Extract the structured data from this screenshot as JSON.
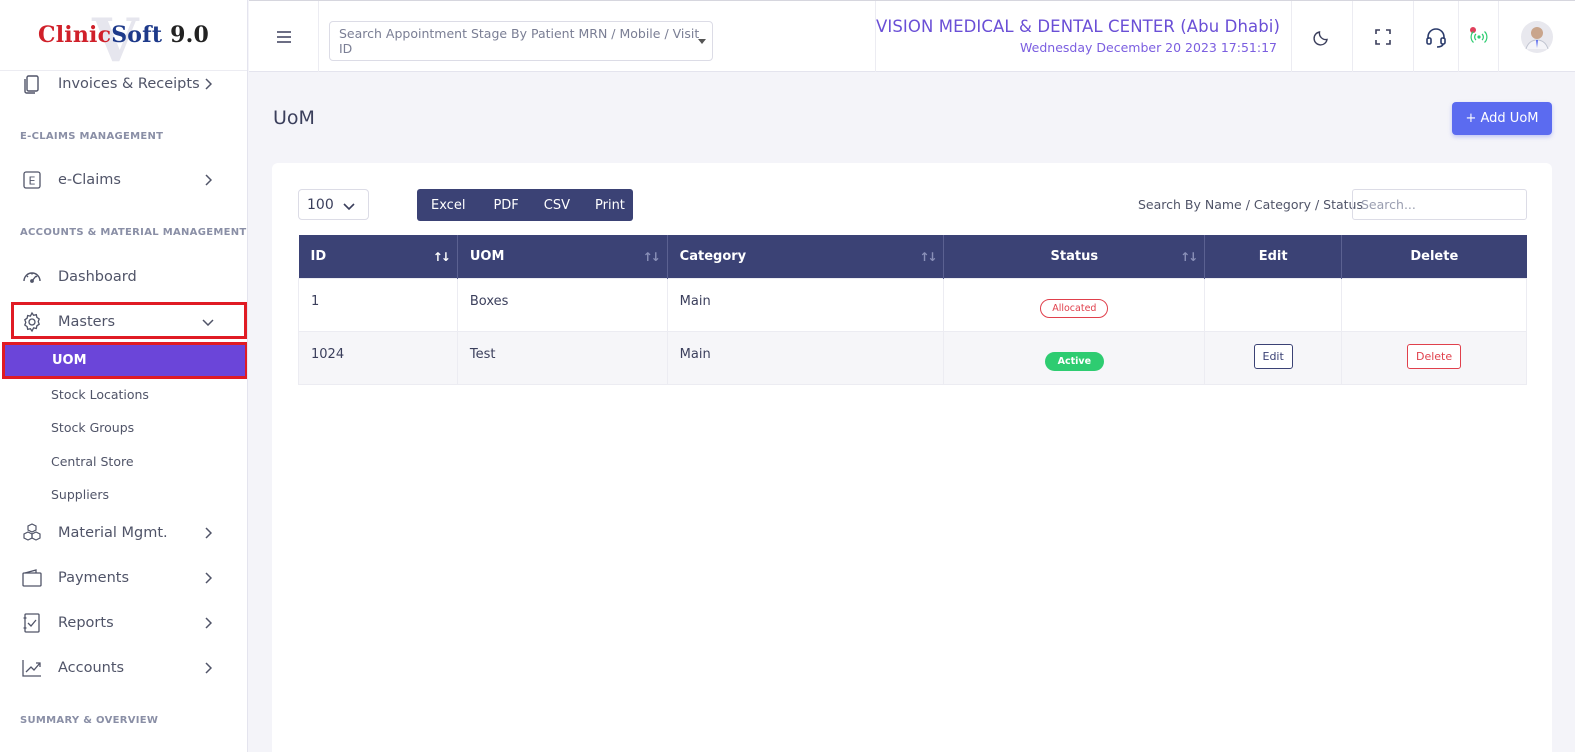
{
  "logo": {
    "part1": "Clinic",
    "part2": "Soft",
    "part3": " 9.0",
    "watermark": "V"
  },
  "sidebar": {
    "invoices": "Invoices & Receipts",
    "section_eclaims": "E-CLAIMS MANAGEMENT",
    "eclaims": "e-Claims",
    "section_accounts": "ACCOUNTS & MATERIAL MANAGEMENT",
    "dashboard": "Dashboard",
    "masters": "Masters",
    "uom": "UOM",
    "stock_locations": "Stock Locations",
    "stock_groups": "Stock Groups",
    "central_store": "Central Store",
    "suppliers": "Suppliers",
    "material_mgmt": "Material Mgmt.",
    "payments": "Payments",
    "reports": "Reports",
    "accounts": "Accounts",
    "section_summary": "SUMMARY & OVERVIEW"
  },
  "header": {
    "search_placeholder": "Search Appointment Stage By Patient MRN / Mobile / Visit ID",
    "center_name": "VISION MEDICAL & DENTAL CENTER (Abu Dhabi)",
    "datetime": "Wednesday December 20 2023 17:51:17"
  },
  "page": {
    "title": "UoM",
    "add_button": "+ Add UoM",
    "page_length": "100",
    "export_buttons": [
      "Excel",
      "PDF",
      "CSV",
      "Print"
    ],
    "search_label": "Search By Name / Category / Status",
    "search_placeholder": "Search..."
  },
  "table": {
    "headers": [
      "ID",
      "UOM",
      "Category",
      "Status",
      "Edit",
      "Delete"
    ],
    "rows": [
      {
        "id": "1",
        "uom": "Boxes",
        "category": "Main",
        "status": "Allocated",
        "edit": "",
        "delete": ""
      },
      {
        "id": "1024",
        "uom": "Test",
        "category": "Main",
        "status": "Active",
        "edit": "Edit",
        "delete": "Delete"
      }
    ]
  },
  "colors": {
    "accent": "#6b45d9",
    "table_header": "#3b4275",
    "primary_button": "#5b6bf0",
    "active": "#2ecc71",
    "danger": "#e0404c",
    "highlight_box": "#e01b24"
  }
}
